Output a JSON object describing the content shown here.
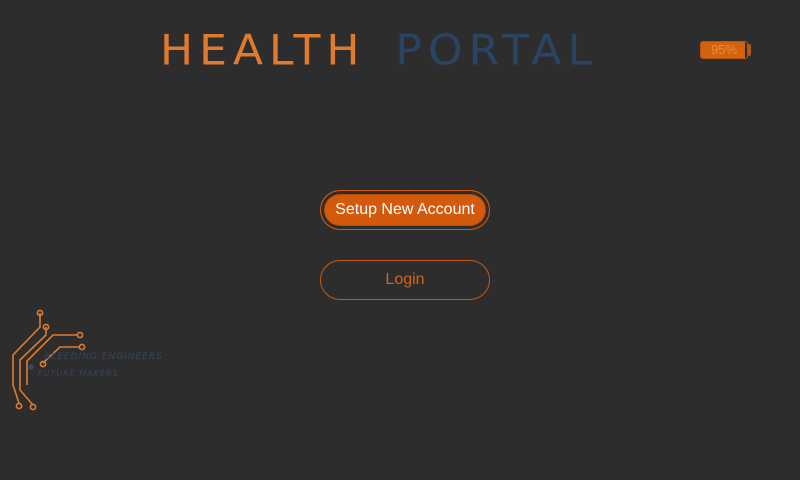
{
  "header": {
    "title_part1": "HEALTH",
    "title_part2": "PORTAL"
  },
  "battery": {
    "label": "95%",
    "level": 0.95
  },
  "actions": {
    "setup_label": "Setup New Account",
    "login_label": "Login"
  },
  "logo": {
    "line1": "BLEEDING ENGINEERS",
    "line2": "FUTURE MAKERS"
  },
  "colors": {
    "background": "#2d2d2d",
    "accent": "#d35a0c",
    "title_orange": "#e07a2e",
    "title_blue": "#2a4563"
  }
}
